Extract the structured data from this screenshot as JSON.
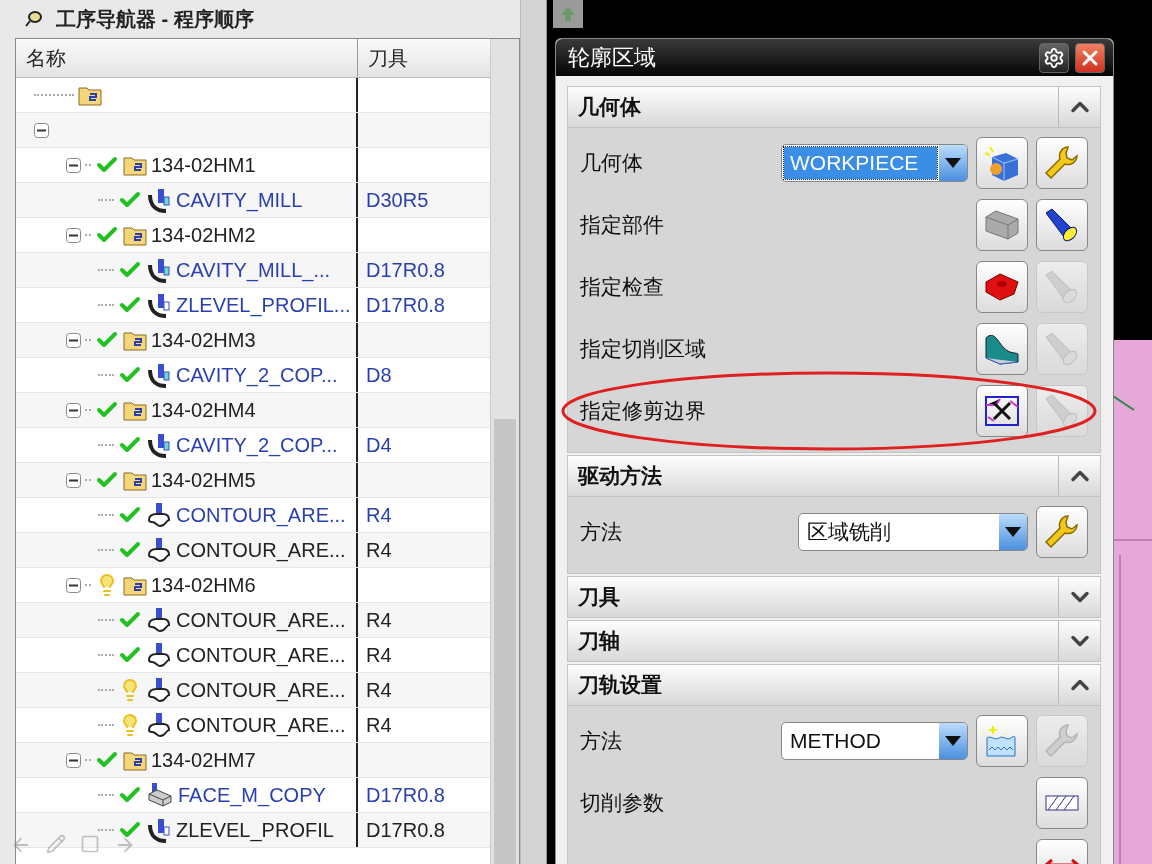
{
  "navigator": {
    "title": "工序导航器 - 程序顺序",
    "columns": [
      "名称",
      "刀具"
    ],
    "tree": [
      {
        "kind": "folder"
      },
      {
        "kind": "root",
        "expanded": true,
        "children": [
          {
            "kind": "program",
            "name": "134-02HM1",
            "complete": true,
            "expanded": true,
            "children": [
              {
                "kind": "cavity",
                "name": "CAVITY_MILL",
                "tool": "D30R5",
                "complete": true,
                "highlighted": true
              }
            ]
          },
          {
            "kind": "program",
            "name": "134-02HM2",
            "complete": true,
            "expanded": true,
            "children": [
              {
                "kind": "cavity",
                "name": "CAVITY_MILL_...",
                "tool": "D17R0.8",
                "complete": true,
                "highlighted": true
              },
              {
                "kind": "zlevel",
                "name": "ZLEVEL_PROFIL...",
                "tool": "D17R0.8",
                "complete": true,
                "highlighted": true
              }
            ]
          },
          {
            "kind": "program",
            "name": "134-02HM3",
            "complete": true,
            "expanded": true,
            "children": [
              {
                "kind": "cavity",
                "name": "CAVITY_2_COP...",
                "tool": "D8",
                "complete": true,
                "highlighted": true
              }
            ]
          },
          {
            "kind": "program",
            "name": "134-02HM4",
            "complete": true,
            "expanded": true,
            "children": [
              {
                "kind": "cavity",
                "name": "CAVITY_2_COP...",
                "tool": "D4",
                "complete": true,
                "highlighted": true
              }
            ]
          },
          {
            "kind": "program",
            "name": "134-02HM5",
            "complete": true,
            "expanded": true,
            "children": [
              {
                "kind": "contour",
                "name": "CONTOUR_ARE...",
                "tool": "R4",
                "complete": true,
                "highlighted": true
              },
              {
                "kind": "contour",
                "name": "CONTOUR_ARE...",
                "tool": "R4",
                "complete": true,
                "highlighted": false
              }
            ]
          },
          {
            "kind": "program",
            "name": "134-02HM6",
            "complete": false,
            "expanded": true,
            "children": [
              {
                "kind": "contour",
                "name": "CONTOUR_ARE...",
                "tool": "R4",
                "complete": true,
                "highlighted": false
              },
              {
                "kind": "contour",
                "name": "CONTOUR_ARE...",
                "tool": "R4",
                "complete": true,
                "highlighted": false
              },
              {
                "kind": "contour",
                "name": "CONTOUR_ARE...",
                "tool": "R4",
                "complete": false,
                "highlighted": false
              },
              {
                "kind": "contour",
                "name": "CONTOUR_ARE...",
                "tool": "R4",
                "complete": false,
                "highlighted": false
              }
            ]
          },
          {
            "kind": "program",
            "name": "134-02HM7",
            "complete": true,
            "expanded": true,
            "children": [
              {
                "kind": "face",
                "name": "FACE_M_COPY",
                "tool": "D17R0.8",
                "complete": true,
                "highlighted": true
              },
              {
                "kind": "zlevel",
                "name": "ZLEVEL_PROFIL",
                "tool": "D17R0.8",
                "complete": true,
                "highlighted": false
              }
            ]
          }
        ]
      }
    ]
  },
  "dialog": {
    "title": "轮廓区域",
    "sections": [
      {
        "title": "几何体",
        "expanded": true,
        "rows": [
          {
            "label": "几何体",
            "dropdown": {
              "value": "WORKPIECE",
              "focused": true
            },
            "buttons": [
              {
                "kind": "new-geometry",
                "disabled": false
              },
              {
                "kind": "edit",
                "disabled": false
              }
            ],
            "annotated": false
          },
          {
            "label": "指定部件",
            "buttons": [
              {
                "kind": "part",
                "disabled": false
              },
              {
                "kind": "display",
                "disabled": false
              }
            ],
            "annotated": false
          },
          {
            "label": "指定检查",
            "buttons": [
              {
                "kind": "check",
                "disabled": false
              },
              {
                "kind": "display",
                "disabled": true
              }
            ],
            "annotated": false
          },
          {
            "label": "指定切削区域",
            "buttons": [
              {
                "kind": "cut-area",
                "disabled": false
              },
              {
                "kind": "display",
                "disabled": true
              }
            ],
            "annotated": false
          },
          {
            "label": "指定修剪边界",
            "buttons": [
              {
                "kind": "trim",
                "disabled": false
              },
              {
                "kind": "display",
                "disabled": true
              }
            ],
            "annotated": true
          }
        ]
      },
      {
        "title": "驱动方法",
        "expanded": true,
        "rows": [
          {
            "label": "方法",
            "dropdown": {
              "value": "区域铣削",
              "focused": false
            },
            "buttons": [
              {
                "kind": "edit",
                "disabled": false
              }
            ],
            "annotated": false
          }
        ]
      },
      {
        "title": "刀具",
        "expanded": false
      },
      {
        "title": "刀轴",
        "expanded": false
      },
      {
        "title": "刀轨设置",
        "expanded": true,
        "rows": [
          {
            "label": "方法",
            "dropdown": {
              "value": "METHOD",
              "focused": false
            },
            "buttons": [
              {
                "kind": "new-method",
                "disabled": false
              },
              {
                "kind": "edit",
                "disabled": true
              }
            ],
            "annotated": false
          },
          {
            "label": "切削参数",
            "buttons": [
              {
                "kind": "cut-params",
                "disabled": false
              }
            ],
            "annotated": false
          },
          {
            "buttons": [
              {
                "kind": "moves",
                "disabled": false
              }
            ],
            "annotated": false
          }
        ]
      }
    ]
  }
}
